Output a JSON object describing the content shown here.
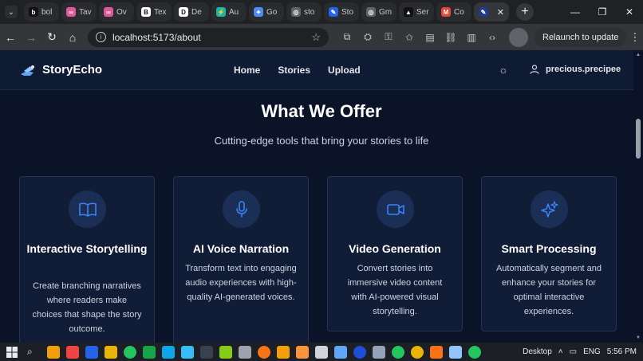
{
  "browser": {
    "tabs": [
      {
        "label": "bol",
        "fav_color": "#111111",
        "fav_char": "b"
      },
      {
        "label": "Tav",
        "fav_color": "#e0579c",
        "fav_char": "∞"
      },
      {
        "label": "Ov",
        "fav_color": "#e0579c",
        "fav_char": "∞"
      },
      {
        "label": "Tex",
        "fav_color": "#ffffff",
        "fav_char": "B"
      },
      {
        "label": "De",
        "fav_color": "#ffffff",
        "fav_char": "D"
      },
      {
        "label": "Au",
        "fav_color": "#14b8a6",
        "fav_char": "⚡"
      },
      {
        "label": "Go",
        "fav_color": "#4c8bf5",
        "fav_char": "✦"
      },
      {
        "label": "sto",
        "fav_color": "#5f6368",
        "fav_char": "◎"
      },
      {
        "label": "Sto",
        "fav_color": "#2563eb",
        "fav_char": "✎"
      },
      {
        "label": "Gm",
        "fav_color": "#5f6368",
        "fav_char": "◎"
      },
      {
        "label": "Ser",
        "fav_color": "#111111",
        "fav_char": "▲"
      },
      {
        "label": "Co",
        "fav_color": "#ea4335",
        "fav_char": "M"
      }
    ],
    "active_tab_close": "✕",
    "new_tab": "+",
    "window_controls": [
      "—",
      "❐",
      "✕"
    ],
    "url": "localhost:5173/about",
    "relaunch_label": "Relaunch to update",
    "kebab": "⋮"
  },
  "site": {
    "brand": "StoryEcho",
    "nav": [
      "Home",
      "Stories",
      "Upload"
    ],
    "username": "precious.precipee",
    "accent": "#3b82f6"
  },
  "section": {
    "title": "What We Offer",
    "subtitle": "Cutting-edge tools that bring your stories to life"
  },
  "cards": [
    {
      "icon": "book-open-icon",
      "title": "Interactive Storytelling",
      "desc": "Create branching narratives where readers make choices that shape the story outcome."
    },
    {
      "icon": "microphone-icon",
      "title": "AI Voice Narration",
      "desc": "Transform text into engaging audio experiences with high-quality AI-generated voices."
    },
    {
      "icon": "video-camera-icon",
      "title": "Video Generation",
      "desc": "Convert stories into immersive video content with AI-powered visual storytelling."
    },
    {
      "icon": "sparkles-icon",
      "title": "Smart Processing",
      "desc": "Automatically segment and enhance your stories for optimal interactive experiences."
    }
  ],
  "taskbar": {
    "desktop_label": "Desktop",
    "language": "ENG",
    "time": "5:56 PM"
  }
}
